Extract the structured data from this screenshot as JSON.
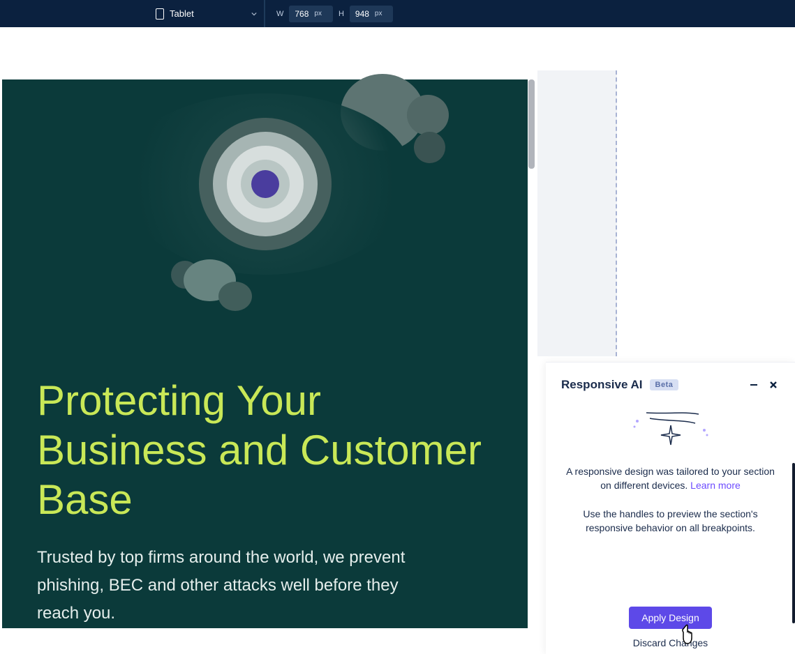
{
  "toolbar": {
    "device_label": "Tablet",
    "w_label": "W",
    "h_label": "H",
    "width_value": "768",
    "height_value": "948",
    "unit": "px"
  },
  "preview": {
    "hero_title": "Protecting Your Business and Customer Base",
    "hero_subtitle": "Trusted by top firms around the world, we prevent phishing, BEC and other attacks well before they reach you."
  },
  "ai_panel": {
    "title": "Responsive AI",
    "badge": "Beta",
    "message_1_a": "A responsive design was tailored to your section on different devices. ",
    "message_1_link": "Learn more",
    "message_2": "Use the handles to preview the section's responsive behavior on all breakpoints.",
    "apply_label": "Apply Design",
    "discard_label": "Discard Changes"
  }
}
